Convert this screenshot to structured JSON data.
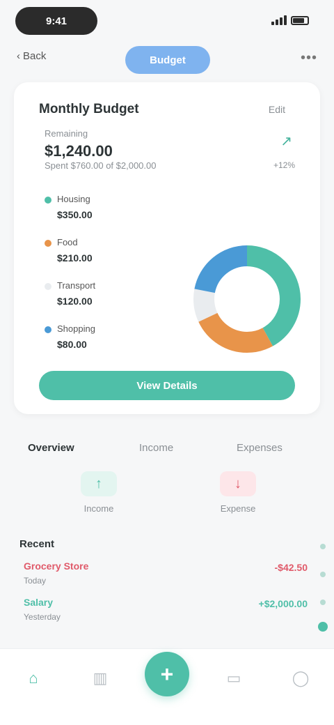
{
  "status_bar": {
    "time": "9:41"
  },
  "nav": {
    "back_label": "Back",
    "pill_label": "Budget",
    "more_icon": "more-icon"
  },
  "budget": {
    "title": "Monthly Budget",
    "link_label": "Edit",
    "remaining_label": "Remaining",
    "remaining_amount": "$1,240.00",
    "spent_text": "Spent $760.00 of $2,000.00",
    "trend_label": "+12%",
    "categories": [
      {
        "name": "Housing",
        "amount": "$350.00",
        "color": "#4fbfa8",
        "share": 0.42
      },
      {
        "name": "Food",
        "amount": "$210.00",
        "color": "#e8944a",
        "share": 0.26
      },
      {
        "name": "Transport",
        "amount": "$120.00",
        "color": "#e9ecef",
        "share": 0.1
      },
      {
        "name": "Shopping",
        "amount": "$80.00",
        "color": "#4a9ad6",
        "share": 0.22
      }
    ],
    "button_label": "View Details"
  },
  "tabs": [
    {
      "label": "Overview",
      "active": true
    },
    {
      "label": "Income",
      "active": false
    },
    {
      "label": "Expenses",
      "active": false
    }
  ],
  "summary": [
    {
      "label": "Income",
      "icon": "arrow-up-icon",
      "glyph": "↑",
      "color": "#4fbfa8",
      "bg": "#e3f5f0"
    },
    {
      "label": "Expense",
      "icon": "arrow-down-icon",
      "glyph": "↓",
      "color": "#e05a6a",
      "bg": "#fde6e9"
    }
  ],
  "transactions": {
    "header": "Recent",
    "items": [
      {
        "name": "Grocery Store",
        "date": "Today",
        "amount": "-$42.50",
        "color": "#e05a6a"
      },
      {
        "name": "Salary",
        "date": "Yesterday",
        "amount": "+$2,000.00",
        "color": "#4fbfa8"
      }
    ]
  },
  "bottom_nav": {
    "items": [
      {
        "name": "home-icon",
        "glyph": "⌂",
        "active": true
      },
      {
        "name": "chart-icon",
        "glyph": "▥",
        "active": false
      },
      {
        "name": "wallet-icon",
        "glyph": "▭",
        "active": false
      },
      {
        "name": "profile-icon",
        "glyph": "◯",
        "active": false
      }
    ],
    "fab_glyph": "+"
  }
}
